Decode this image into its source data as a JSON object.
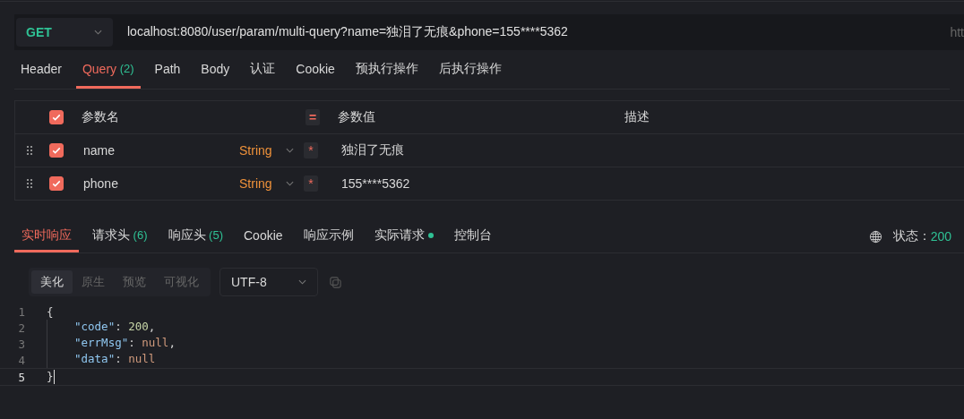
{
  "request": {
    "method": "GET",
    "url": "localhost:8080/user/param/multi-query?name=独泪了无痕&phone=155****5362",
    "url_hint": "htt"
  },
  "request_tabs": [
    {
      "label": "Header",
      "selected": false
    },
    {
      "label": "Query",
      "count": "(2)",
      "selected": true
    },
    {
      "label": "Path",
      "selected": false
    },
    {
      "label": "Body",
      "selected": false
    },
    {
      "label": "认证",
      "selected": false
    },
    {
      "label": "Cookie",
      "selected": false
    },
    {
      "label": "预执行操作",
      "selected": false
    },
    {
      "label": "后执行操作",
      "selected": false
    }
  ],
  "params": {
    "header": {
      "checked": true,
      "name": "参数名",
      "equals": "=",
      "value": "参数值",
      "description": "描述"
    },
    "rows": [
      {
        "checked": true,
        "name": "name",
        "type": "String",
        "required": "*",
        "value": "独泪了无痕"
      },
      {
        "checked": true,
        "name": "phone",
        "type": "String",
        "required": "*",
        "value": "155****5362"
      }
    ]
  },
  "response_tabs": [
    {
      "label": "实时响应",
      "selected": true
    },
    {
      "label": "请求头",
      "count": "(6)",
      "selected": false
    },
    {
      "label": "响应头",
      "count": "(5)",
      "selected": false
    },
    {
      "label": "Cookie",
      "selected": false
    },
    {
      "label": "响应示例",
      "selected": false
    },
    {
      "label": "实际请求",
      "dot": true,
      "selected": false
    },
    {
      "label": "控制台",
      "selected": false
    }
  ],
  "status": {
    "label": "状态：",
    "code": "200"
  },
  "view_modes": [
    {
      "label": "美化",
      "selected": true
    },
    {
      "label": "原生",
      "selected": false
    },
    {
      "label": "预览",
      "selected": false
    },
    {
      "label": "可视化",
      "selected": false
    }
  ],
  "encoding": "UTF-8",
  "code": [
    {
      "number": "1",
      "current": false,
      "tokens": [
        {
          "kind": "punct",
          "text": "{"
        }
      ]
    },
    {
      "number": "2",
      "current": false,
      "indent": true,
      "tokens": [
        {
          "kind": "key",
          "text": "\"code\""
        },
        {
          "kind": "punct",
          "text": ": "
        },
        {
          "kind": "number",
          "text": "200"
        },
        {
          "kind": "punct",
          "text": ","
        }
      ]
    },
    {
      "number": "3",
      "current": false,
      "indent": true,
      "tokens": [
        {
          "kind": "key",
          "text": "\"errMsg\""
        },
        {
          "kind": "punct",
          "text": ": "
        },
        {
          "kind": "null",
          "text": "null"
        },
        {
          "kind": "punct",
          "text": ","
        }
      ]
    },
    {
      "number": "4",
      "current": false,
      "indent": true,
      "tokens": [
        {
          "kind": "key",
          "text": "\"data\""
        },
        {
          "kind": "punct",
          "text": ": "
        },
        {
          "kind": "null",
          "text": "null"
        }
      ]
    },
    {
      "number": "5",
      "current": true,
      "tokens": [
        {
          "kind": "punct",
          "text": "}"
        }
      ]
    }
  ]
}
